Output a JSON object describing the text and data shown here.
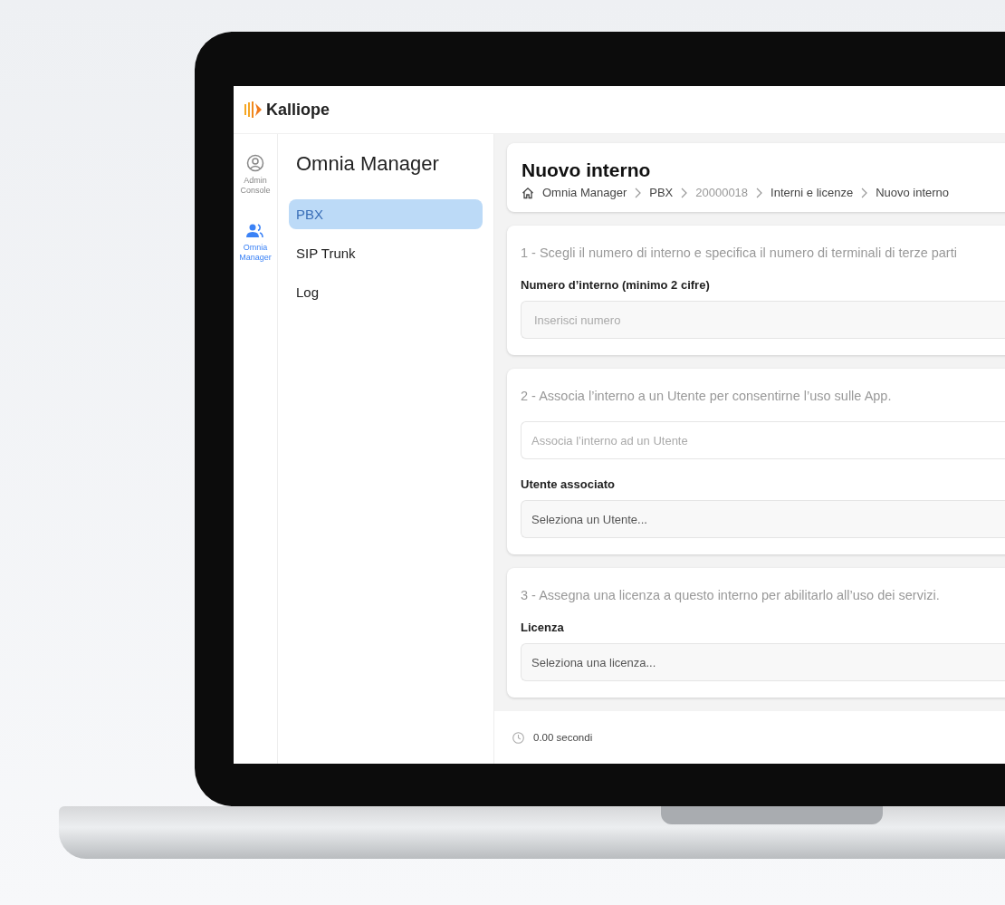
{
  "app": {
    "logo_text": "Kalliope"
  },
  "rail": [
    {
      "label": "Admin Console",
      "selected": false
    },
    {
      "label": "Omnia Manager",
      "selected": true
    }
  ],
  "nav": {
    "title": "Omnia Manager",
    "items": [
      {
        "label": "PBX",
        "selected": true
      },
      {
        "label": "SIP Trunk",
        "selected": false
      },
      {
        "label": "Log",
        "selected": false
      }
    ]
  },
  "page": {
    "title": "Nuovo interno",
    "breadcrumb": [
      {
        "label": "Omnia Manager",
        "muted": false
      },
      {
        "label": "PBX",
        "muted": false
      },
      {
        "label": "20000018",
        "muted": true
      },
      {
        "label": "Interni e licenze",
        "muted": false
      },
      {
        "label": "Nuovo interno",
        "muted": false
      }
    ]
  },
  "sections": [
    {
      "heading": "1 - Scegli il numero di interno e specifica il numero di terminali di terze parti",
      "fields": [
        {
          "kind": "input",
          "label": "Numero d’interno (minimo 2 cifre)",
          "placeholder": "Inserisci numero"
        }
      ]
    },
    {
      "heading": "2 - Associa l’interno a un Utente per consentirne l’uso sulle App.",
      "fields": [
        {
          "kind": "search",
          "placeholder": "Associa l’interno ad un Utente"
        },
        {
          "kind": "select",
          "label": "Utente associato",
          "value": "Seleziona un Utente..."
        }
      ]
    },
    {
      "heading": "3 - Assegna una licenza a questo interno per abilitarlo all’uso dei servizi.",
      "fields": [
        {
          "kind": "select",
          "label": "Licenza",
          "value": "Seleziona una licenza..."
        }
      ]
    }
  ],
  "footer": {
    "timing": "0.00 secondi"
  }
}
